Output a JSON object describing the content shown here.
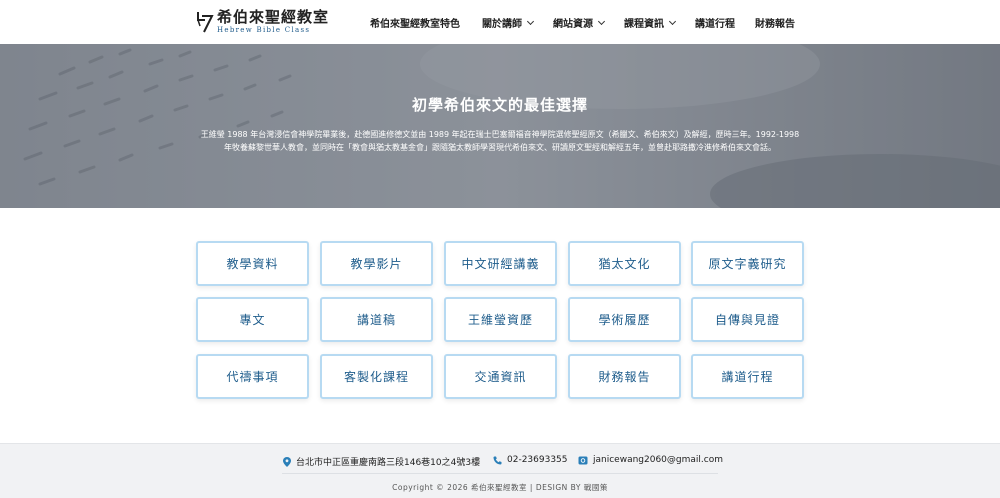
{
  "logo": {
    "title": "希伯來聖經教室",
    "subtitle": "Hebrew Bible Class"
  },
  "nav": [
    {
      "label": "希伯來聖經教室特色",
      "dropdown": false
    },
    {
      "label": "關於講師",
      "dropdown": true
    },
    {
      "label": "網站資源",
      "dropdown": true
    },
    {
      "label": "課程資訊",
      "dropdown": true
    },
    {
      "label": "講道行程",
      "dropdown": false
    },
    {
      "label": "財務報告",
      "dropdown": false
    }
  ],
  "hero": {
    "title": "初學希伯來文的最佳選擇",
    "description": "王維瑩 1988 年台灣浸信會神學院畢業後，赴德國進修德文並由 1989 年起在瑞士巴塞爾福音神學院選修聖經原文（希臘文、希伯來文）及解經，歷時三年。1992-1998 年牧養蘇黎世華人教會，並同時在「教會與猶太教基金會」跟隨猶太教師學習現代希伯來文、研讀原文聖經和解經五年，並曾赴耶路撒冷進修希伯來文會話。"
  },
  "tiles": [
    "教學資料",
    "教學影片",
    "中文研經講義",
    "猶太文化",
    "原文字義研究",
    "專文",
    "講道稿",
    "王維瑩資歷",
    "學術履歷",
    "自傳與見證",
    "代禱事項",
    "客製化課程",
    "交通資訊",
    "財務報告",
    "講道行程"
  ],
  "footer": {
    "address": "台北市中正區重慶南路三段146巷10之4號3樓",
    "phone": "02-23693355",
    "email": "janicewang2060@gmail.com",
    "copyright": "Copyright ©  2026  希伯來聖經教室  |  DESIGN BY 戰國策"
  },
  "colors": {
    "accent": "#1f5d8c",
    "tile_border": "#b7daf2",
    "icon": "#2a7fb8",
    "footer_bg": "#f1f2f4"
  },
  "icons": {
    "address": "map-pin-icon",
    "phone": "phone-icon",
    "email": "email-icon"
  }
}
